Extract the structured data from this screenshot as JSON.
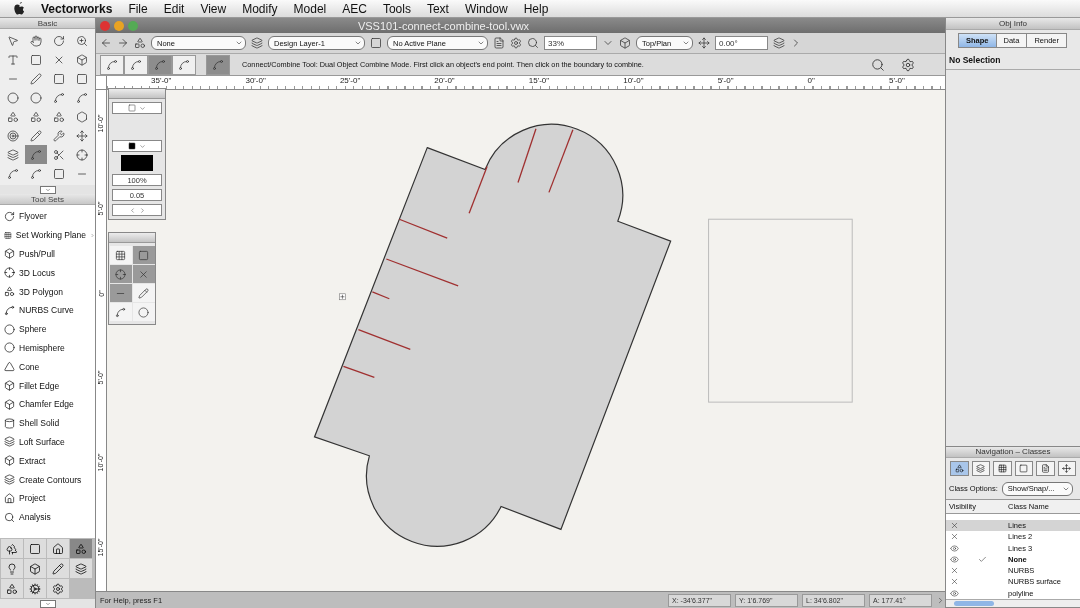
{
  "menu_bar": {
    "app": "Vectorworks",
    "items": [
      "File",
      "Edit",
      "View",
      "Modify",
      "Model",
      "AEC",
      "Tools",
      "Text",
      "Window",
      "Help"
    ]
  },
  "basic_palette": {
    "title": "Basic",
    "tools": [
      {
        "selected": false
      },
      {
        "selected": false
      },
      {
        "selected": false
      },
      {
        "selected": false
      },
      {
        "selected": false
      },
      {
        "selected": false
      },
      {
        "selected": false
      },
      {
        "selected": false
      },
      {
        "selected": false
      },
      {
        "selected": false
      },
      {
        "selected": false
      },
      {
        "selected": false
      },
      {
        "selected": false
      },
      {
        "selected": false
      },
      {
        "selected": false
      },
      {
        "selected": false
      },
      {
        "selected": false
      },
      {
        "selected": false
      },
      {
        "selected": false
      },
      {
        "selected": false
      },
      {
        "selected": false
      },
      {
        "selected": false
      },
      {
        "selected": false
      },
      {
        "selected": false
      },
      {
        "selected": false
      },
      {
        "selected": true
      },
      {
        "selected": false
      },
      {
        "selected": false
      },
      {
        "selected": false
      },
      {
        "selected": false
      },
      {
        "selected": false
      },
      {
        "selected": false
      }
    ]
  },
  "tool_sets": {
    "title": "Tool Sets",
    "items": [
      {
        "label": "Flyover"
      },
      {
        "label": "Set Working Plane",
        "submenu": true
      },
      {
        "label": "Push/Pull"
      },
      {
        "label": "3D Locus"
      },
      {
        "label": "3D Polygon"
      },
      {
        "label": "NURBS Curve"
      },
      {
        "label": "Sphere"
      },
      {
        "label": "Hemisphere"
      },
      {
        "label": "Cone"
      },
      {
        "label": "Fillet Edge"
      },
      {
        "label": "Chamfer Edge"
      },
      {
        "label": "Shell Solid"
      },
      {
        "label": "Loft Surface"
      },
      {
        "label": "Extract"
      },
      {
        "label": "Create Contours"
      },
      {
        "label": "Project"
      },
      {
        "label": "Analysis"
      }
    ],
    "sets": [
      {
        "selected": false
      },
      {
        "selected": false
      },
      {
        "selected": false
      },
      {
        "selected": true
      },
      {
        "selected": false
      },
      {
        "selected": false
      },
      {
        "selected": false
      },
      {
        "selected": false
      },
      {
        "selected": false
      },
      {
        "selected": false
      },
      {
        "selected": false
      }
    ]
  },
  "window": {
    "title": "VSS101-connect-combine-tool.vwx"
  },
  "toolbar": {
    "class": "None",
    "layer": "Design Layer-1",
    "plane": "No Active Plane",
    "zoom": "33%",
    "view": "Top/Plan",
    "angle": "0.00°"
  },
  "mode_bar": {
    "modes": [
      {
        "selected": false
      },
      {
        "selected": false
      },
      {
        "selected": true
      },
      {
        "selected": false
      }
    ],
    "option_on": true,
    "message": "Connect/Combine Tool: Dual Object Combine Mode. First click an object's end point. Then click on the boundary to combine."
  },
  "rulers": {
    "top": [
      "35'-0\"",
      "30'-0\"",
      "25'-0\"",
      "20'-0\"",
      "15'-0\"",
      "10'-0\"",
      "5'-0\"",
      "0\"",
      "5'-0\""
    ],
    "left": [
      "10'-0\"",
      "5'-0\"",
      "0\"",
      "5'-0\"",
      "10'-0\"",
      "15'-0\""
    ]
  },
  "attributes_palette": {
    "opacity": "100%",
    "line_weight": "0.05"
  },
  "snap_palette": {
    "buttons": [
      {
        "selected": false
      },
      {
        "selected": true
      },
      {
        "selected": true
      },
      {
        "selected": true
      },
      {
        "selected": true
      },
      {
        "selected": false
      },
      {
        "selected": false
      },
      {
        "selected": false
      }
    ]
  },
  "obj_info": {
    "title": "Obj Info",
    "tabs": [
      {
        "label": "Shape",
        "selected": true
      },
      {
        "label": "Data",
        "selected": false
      },
      {
        "label": "Render",
        "selected": false
      }
    ],
    "status": "No Selection"
  },
  "navigation": {
    "title": "Navigation – Classes",
    "options_label": "Class Options:",
    "options_value": "Show/Snap/...",
    "columns": [
      "Visibility",
      "Class Name"
    ],
    "tabs": [
      {
        "selected": true
      },
      {
        "selected": false
      },
      {
        "selected": false
      },
      {
        "selected": false
      },
      {
        "selected": false
      },
      {
        "selected": false
      }
    ],
    "rows": [
      {
        "name": "Lines",
        "visible": false,
        "active": false,
        "selected": true
      },
      {
        "name": "Lines 2",
        "visible": false,
        "active": false,
        "selected": false
      },
      {
        "name": "Lines 3",
        "visible": true,
        "active": false,
        "selected": false
      },
      {
        "name": "None",
        "visible": true,
        "active": true,
        "selected": false
      },
      {
        "name": "NURBS",
        "visible": false,
        "active": false,
        "selected": false
      },
      {
        "name": "NURBS surface",
        "visible": false,
        "active": false,
        "selected": false
      },
      {
        "name": "polyline",
        "visible": true,
        "active": false,
        "selected": false
      }
    ]
  },
  "status_bar": {
    "help": "For Help, press F1",
    "fields": [
      "X: -34'6.377\"",
      "Y: 1'6.769\"",
      "L: 34'6.802\"",
      "A: 177.41°"
    ]
  }
}
